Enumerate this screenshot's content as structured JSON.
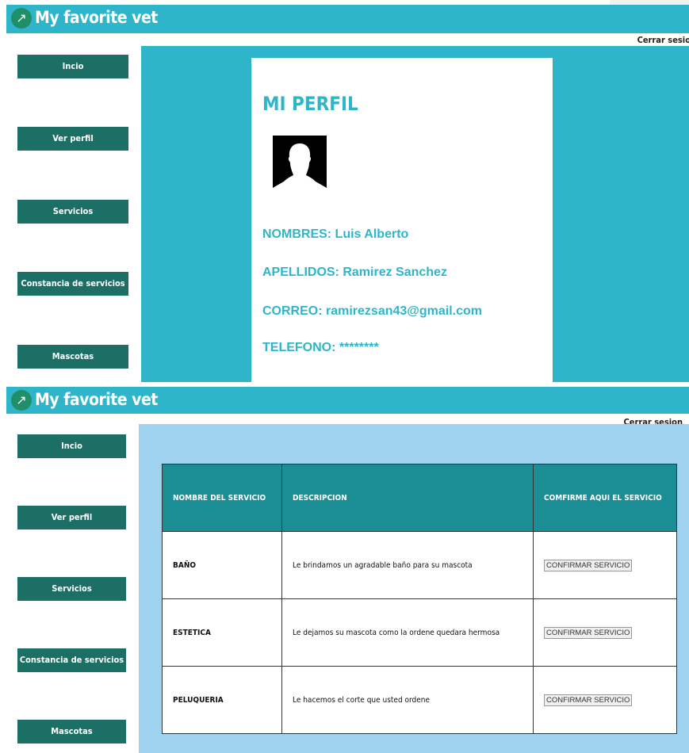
{
  "brand": "My favorite vet",
  "panel1": {
    "logout": "Cerrar sesio",
    "nav": [
      "Incio",
      "Ver perfil",
      "Servicios",
      "Constancia de servicios",
      "Mascotas"
    ],
    "profile": {
      "title": "MI PERFIL",
      "nombres": "NOMBRES: Luis Alberto",
      "apellidos": "APELLIDOS: Ramirez Sanchez",
      "correo": "CORREO: ramirezsan43@gmail.com",
      "telefono": "TELEFONO: ********"
    }
  },
  "panel2": {
    "logout": "Cerrar sesion",
    "nav": [
      "Incio",
      "Ver perfil",
      "Servicios",
      "Constancia de servicios",
      "Mascotas"
    ],
    "table": {
      "headers": [
        "NOMBRE DEL SERVICIO",
        "DESCRIPCION",
        "COMFIRME AQUI EL SERVICIO"
      ],
      "rows": [
        {
          "name": "BAÑO",
          "description": "Le brindamos un agradable baño para su mascota",
          "action": "CONFIRMAR SERVICIO"
        },
        {
          "name": "ESTETICA",
          "description": "Le dejamos su mascota como la ordene quedara hermosa",
          "action": "CONFIRMAR SERVICIO"
        },
        {
          "name": "PELUQUERIA",
          "description": "Le hacemos el corte que usted ordene",
          "action": "CONFIRMAR SERVICIO"
        }
      ]
    }
  },
  "colors": {
    "header": "#2fb5c9",
    "nav_button": "#1b6f64",
    "table_header": "#1b8d94",
    "services_bg": "#9fd2ee"
  }
}
